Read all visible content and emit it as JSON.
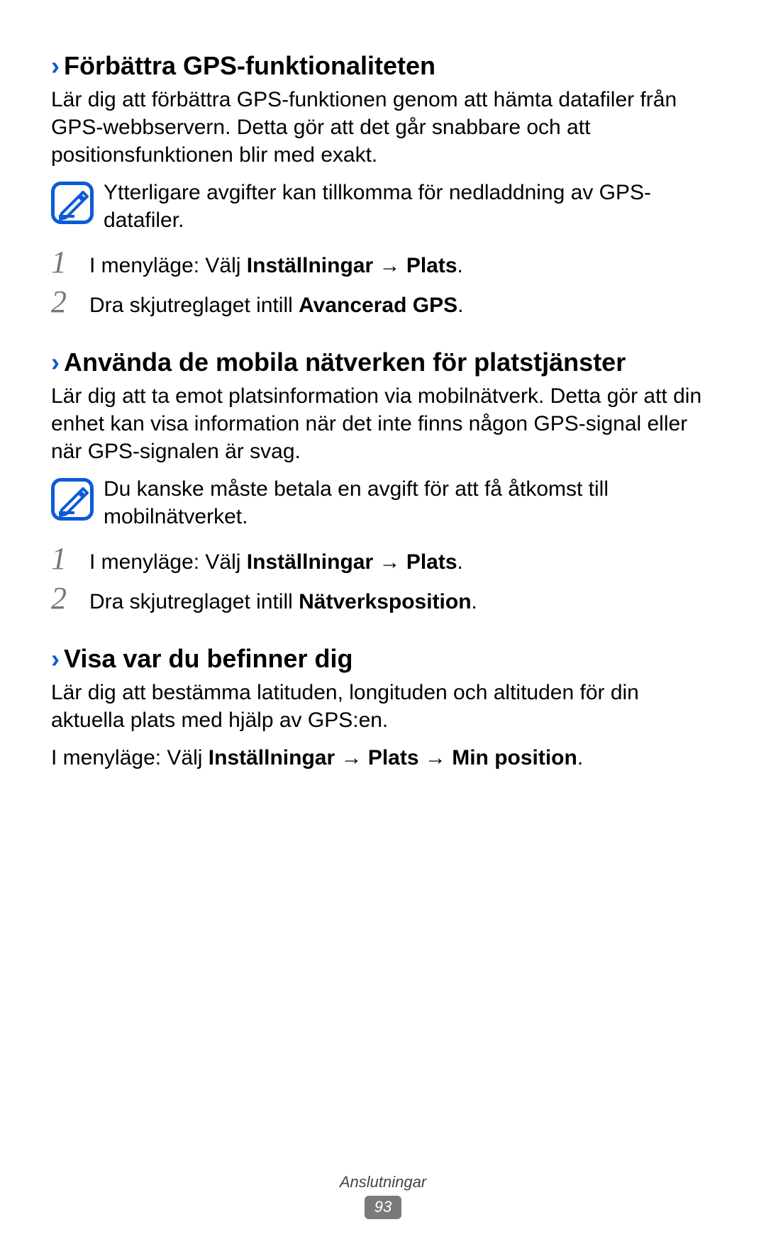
{
  "sections": [
    {
      "heading": "Förbättra GPS-funktionaliteten",
      "intro": "Lär dig att förbättra GPS-funktionen genom att hämta datafiler från GPS-webbservern. Detta gör att det går snabbare och att positionsfunktionen blir med exakt.",
      "note": "Ytterligare avgifter kan tillkomma för nedladdning av GPS-datafiler.",
      "steps": [
        {
          "num": "1",
          "prefix": "I menyläge: Välj ",
          "b1": "Inställningar",
          "arrow": " → ",
          "b2": "Plats",
          "suffix": "."
        },
        {
          "num": "2",
          "prefix": "Dra skjutreglaget intill ",
          "b1": "Avancerad GPS",
          "arrow": "",
          "b2": "",
          "suffix": "."
        }
      ]
    },
    {
      "heading": "Använda de mobila nätverken för platstjänster",
      "intro": "Lär dig att ta emot platsinformation via mobilnätverk. Detta gör att din enhet kan visa information när det inte finns någon GPS-signal eller när GPS-signalen är svag.",
      "note": "Du kanske måste betala en avgift för att få åtkomst till mobilnätverket.",
      "steps": [
        {
          "num": "1",
          "prefix": "I menyläge: Välj ",
          "b1": "Inställningar",
          "arrow": " → ",
          "b2": "Plats",
          "suffix": "."
        },
        {
          "num": "2",
          "prefix": "Dra skjutreglaget intill ",
          "b1": "Nätverksposition",
          "arrow": "",
          "b2": "",
          "suffix": "."
        }
      ]
    },
    {
      "heading": "Visa var du befinner dig",
      "intro": "Lär dig att bestämma latituden, longituden och altituden för din aktuella plats med hjälp av GPS:en.",
      "line": {
        "prefix": "I menyläge: Välj ",
        "b1": "Inställningar",
        "a1": " → ",
        "b2": "Plats",
        "a2": " → ",
        "b3": "Min position",
        "suffix": "."
      }
    }
  ],
  "footer": {
    "label": "Anslutningar",
    "page": "93"
  }
}
